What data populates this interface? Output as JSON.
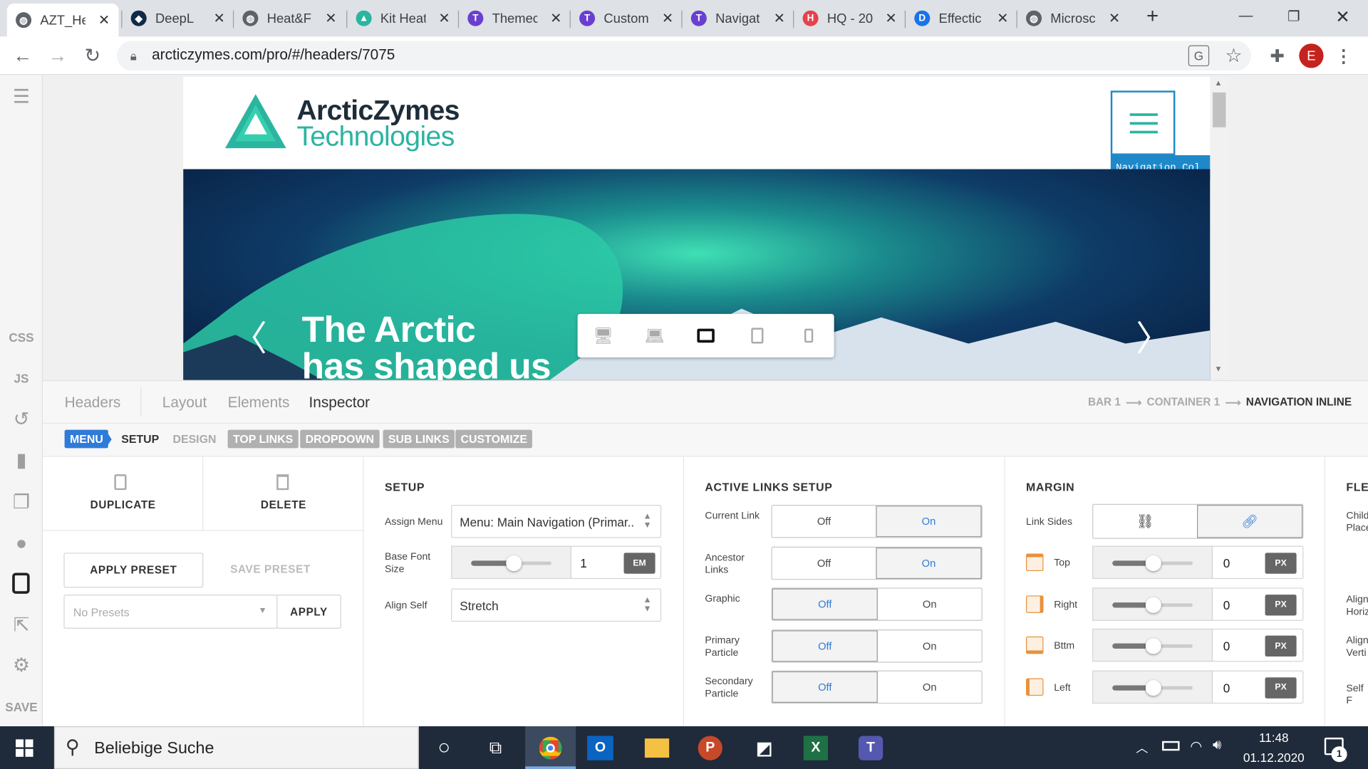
{
  "browser": {
    "tabs": [
      {
        "label": "AZT_He",
        "icon": "globe-icon",
        "color": "#5f6368",
        "glyph": "◍"
      },
      {
        "label": "DeepL",
        "icon": "deepl-icon",
        "color": "#0f2b46",
        "glyph": "◆"
      },
      {
        "label": "Heat&F",
        "icon": "globe-icon",
        "color": "#5f6368",
        "glyph": "◍"
      },
      {
        "label": "Kit Heat",
        "icon": "arcticzymes-icon",
        "color": "#2bb5a0",
        "glyph": "▲"
      },
      {
        "label": "Themec",
        "icon": "themeco-icon",
        "color": "#6a3fd0",
        "glyph": "T"
      },
      {
        "label": "Custom",
        "icon": "themeco-icon",
        "color": "#6a3fd0",
        "glyph": "T"
      },
      {
        "label": "Navigat",
        "icon": "themeco-icon",
        "color": "#6a3fd0",
        "glyph": "T"
      },
      {
        "label": "HQ - 20",
        "icon": "hq-icon",
        "color": "#e4424d",
        "glyph": "H"
      },
      {
        "label": "Effectic",
        "icon": "dsm-icon",
        "color": "#1a73e8",
        "glyph": "D"
      },
      {
        "label": "Microsc",
        "icon": "globe-icon",
        "color": "#5f6368",
        "glyph": "◍"
      }
    ],
    "url": "arcticzymes.com/pro/#/headers/7075",
    "profile_initial": "E"
  },
  "sidebar": {
    "items": [
      "CSS",
      "JS"
    ],
    "save": "SAVE"
  },
  "site": {
    "logo_line1": "ArcticZymes",
    "logo_line2": "Technologies",
    "nav_label": "Navigation Col",
    "hero_line1": "The Arctic",
    "hero_line2": "has shaped us"
  },
  "editor": {
    "tabs": [
      "Headers",
      "Layout",
      "Elements",
      "Inspector"
    ],
    "breadcrumb": [
      "BAR 1",
      "CONTAINER 1",
      "NAVIGATION INLINE"
    ],
    "breadcrumb_sep": "⟶",
    "subtabs": {
      "menu": "MENU",
      "setup": "SETUP",
      "design": "DESIGN",
      "chips": [
        "TOP LINKS",
        "DROPDOWN",
        "SUB LINKS",
        "CUSTOMIZE"
      ]
    },
    "actions": {
      "duplicate": "DUPLICATE",
      "delete": "DELETE",
      "apply_preset": "APPLY PRESET",
      "save_preset": "SAVE PRESET",
      "presets_placeholder": "No Presets",
      "apply": "APPLY"
    },
    "setup": {
      "title": "SETUP",
      "assign_menu_label": "Assign Menu",
      "assign_menu_value": "Menu: Main Navigation (Primar...",
      "font_size_label": "Base Font Size",
      "font_size_value": "1",
      "font_size_unit": "EM",
      "align_self_label": "Align Self",
      "align_self_value": "Stretch"
    },
    "active_links": {
      "title": "ACTIVE LINKS SETUP",
      "off": "Off",
      "on": "On",
      "rows": [
        {
          "label": "Current Link",
          "state": "On"
        },
        {
          "label": "Ancestor Links",
          "state": "On"
        },
        {
          "label": "Graphic",
          "state": "Off"
        },
        {
          "label": "Primary Particle",
          "state": "Off"
        },
        {
          "label": "Secondary Particle",
          "state": "Off"
        }
      ]
    },
    "margin": {
      "title": "MARGIN",
      "link_sides": "Link Sides",
      "sides": [
        {
          "label": "Top",
          "value": "0",
          "unit": "PX"
        },
        {
          "label": "Right",
          "value": "0",
          "unit": "PX"
        },
        {
          "label": "Bttm",
          "value": "0",
          "unit": "PX"
        },
        {
          "label": "Left",
          "value": "0",
          "unit": "PX"
        }
      ]
    },
    "flex": {
      "title": "FLEX",
      "labels": [
        "Child",
        "Place",
        "Align",
        "Horiz",
        "Align",
        "Verti",
        "Self F"
      ]
    }
  },
  "taskbar": {
    "search_placeholder": "Beliebige Suche",
    "time": "11:48",
    "date": "01.12.2020",
    "notifications": "1"
  }
}
